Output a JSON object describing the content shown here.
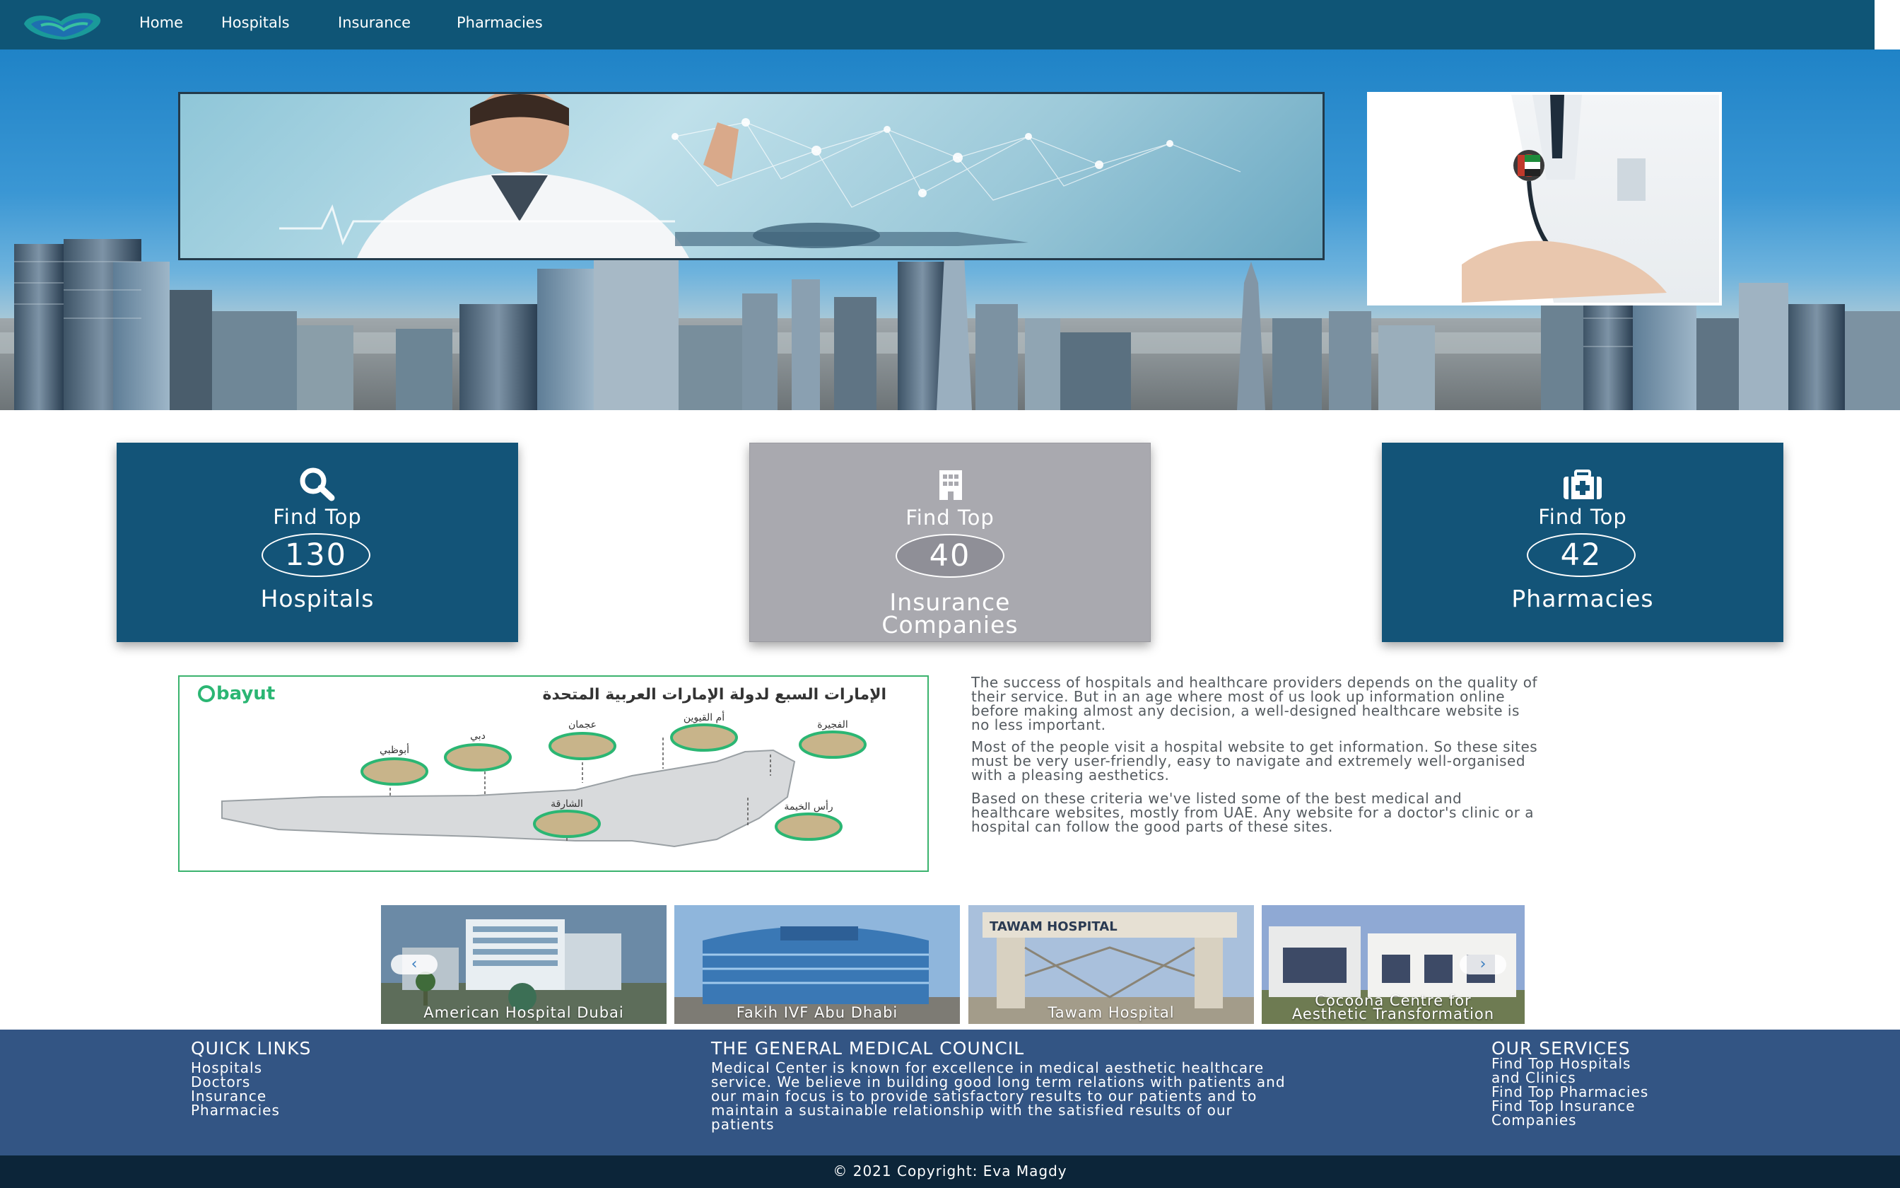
{
  "nav": {
    "links": [
      "Home",
      "Hospitals",
      "Insurance",
      "Pharmacies"
    ]
  },
  "stats": [
    {
      "top": "Find Top",
      "number": "130",
      "label": "Hospitals",
      "icon": "search-icon"
    },
    {
      "top": "Find Top",
      "number": "40",
      "label_line1": "Insurance",
      "label_line2": "Companies",
      "icon": "building-icon"
    },
    {
      "top": "Find Top",
      "number": "42",
      "label": "Pharmacies",
      "icon": "medical-kit-icon"
    }
  ],
  "map": {
    "brand": "bayut",
    "title": "الإمارات السبع لدولة الإمارات العربية المتحدة",
    "cities": [
      "أبوظبي",
      "دبي",
      "عجمان",
      "أم القيوين",
      "الفجيرة",
      "الشارقة",
      "رأس الخيمة"
    ]
  },
  "paragraphs": {
    "p1_lines": [
      "The success of hospitals and healthcare providers depends on the quality of",
      "their service. But in an age where most of us look up information online",
      "before making almost any decision, a well-designed healthcare website is",
      "no less important."
    ],
    "p2_lines": [
      "Most of the people visit a hospital website to get information. So these sites",
      "must be very user-friendly, easy to navigate and extremely well-organised",
      "with a pleasing aesthetics."
    ],
    "p3_lines": [
      "Based on these criteria we've listed some of the best medical and",
      "healthcare websites, mostly from UAE. Any website for a doctor's clinic or a",
      "hospital can follow the good parts of these sites."
    ]
  },
  "carousel": {
    "slides": [
      {
        "caption": "American Hospital Dubai"
      },
      {
        "caption": "Fakih IVF Abu Dhabi"
      },
      {
        "caption": "Tawam Hospital",
        "sign": "TAWAM HOSPITAL"
      },
      {
        "caption_line1": "Cocoona Centre for",
        "caption_line2": "Aesthetic Transformation"
      }
    ],
    "prev": "‹",
    "next": "›"
  },
  "footer": {
    "quick_links_title": "QUICK LINKS",
    "quick_links": [
      "Hospitals",
      "Doctors",
      "Insurance",
      "Pharmacies"
    ],
    "council_title": "THE GENERAL MEDICAL COUNCIL",
    "council_lines": [
      "Medical Center is known for excellence in medical aesthetic healthcare",
      "service. We believe in building good long term relations with patients and",
      "our main focus is to provide satisfactory results to our patients and to",
      "maintain a sustainable relationship with the satisfied results of our",
      "patients"
    ],
    "services_title": "OUR SERVICES",
    "services": [
      {
        "line1": "Find Top Hospitals",
        "line2": "and Clinics"
      },
      {
        "line1": "Find Top Pharmacies"
      },
      {
        "line1": "Find Top Insurance",
        "line2": "Companies"
      }
    ],
    "copyright": "© 2021 Copyright: Eva Magdy"
  },
  "colors": {
    "navbar": "#0f5576",
    "card_blue": "#135478",
    "card_gray": "#a9a9af",
    "footer": "#335584",
    "copyright_bar": "#0c2539",
    "map_border": "#3bb36e"
  }
}
